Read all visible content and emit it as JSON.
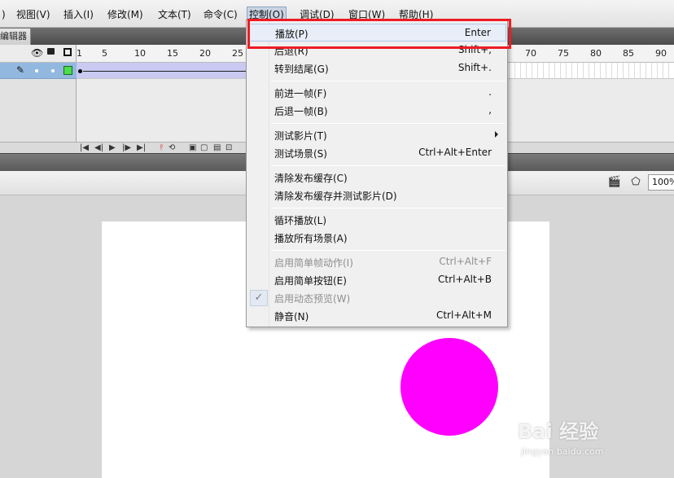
{
  "menubar": {
    "items": [
      {
        "label": ")"
      },
      {
        "label": "视图(V)"
      },
      {
        "label": "插入(I)"
      },
      {
        "label": "修改(M)"
      },
      {
        "label": "文本(T)"
      },
      {
        "label": "命令(C)"
      },
      {
        "label": "控制(O)",
        "active": true
      },
      {
        "label": "调试(D)"
      },
      {
        "label": "窗口(W)"
      },
      {
        "label": "帮助(H)"
      }
    ]
  },
  "timeline": {
    "tab_label": "编辑器",
    "ruler_ticks": [
      "1",
      "5",
      "10",
      "15",
      "20",
      "25",
      "70",
      "75",
      "80",
      "85",
      "90"
    ]
  },
  "toolbar": {
    "zoom": "100%",
    "icons": [
      "edit-scene-icon",
      "edit-symbols-icon"
    ]
  },
  "menu": {
    "items": [
      {
        "label": "播放(P)",
        "shortcut": "Enter",
        "highlighted": true
      },
      {
        "label": "后退(R)",
        "shortcut": "Shift+,"
      },
      {
        "label": "转到结尾(G)",
        "shortcut": "Shift+."
      },
      {
        "label": "前进一帧(F)",
        "shortcut": "."
      },
      {
        "label": "后退一帧(B)",
        "shortcut": ","
      },
      {
        "label": "测试影片(T)",
        "shortcut": "",
        "submenu": true
      },
      {
        "label": "测试场景(S)",
        "shortcut": "Ctrl+Alt+Enter"
      },
      {
        "label": "清除发布缓存(C)",
        "shortcut": ""
      },
      {
        "label": "清除发布缓存并测试影片(D)",
        "shortcut": ""
      },
      {
        "label": "循环播放(L)",
        "shortcut": ""
      },
      {
        "label": "播放所有场景(A)",
        "shortcut": ""
      },
      {
        "label": "启用简单帧动作(I)",
        "shortcut": "Ctrl+Alt+F",
        "disabled": true
      },
      {
        "label": "启用简单按钮(E)",
        "shortcut": "Ctrl+Alt+B"
      },
      {
        "label": "启用动态预览(W)",
        "shortcut": "",
        "disabled": true,
        "checked": true
      },
      {
        "label": "静音(N)",
        "shortcut": "Ctrl+Alt+M"
      }
    ]
  },
  "stage": {
    "shape_color": "#ff00ff"
  },
  "watermark": {
    "brand": "Bai 经验",
    "url": "jingyan.baidu.com"
  }
}
